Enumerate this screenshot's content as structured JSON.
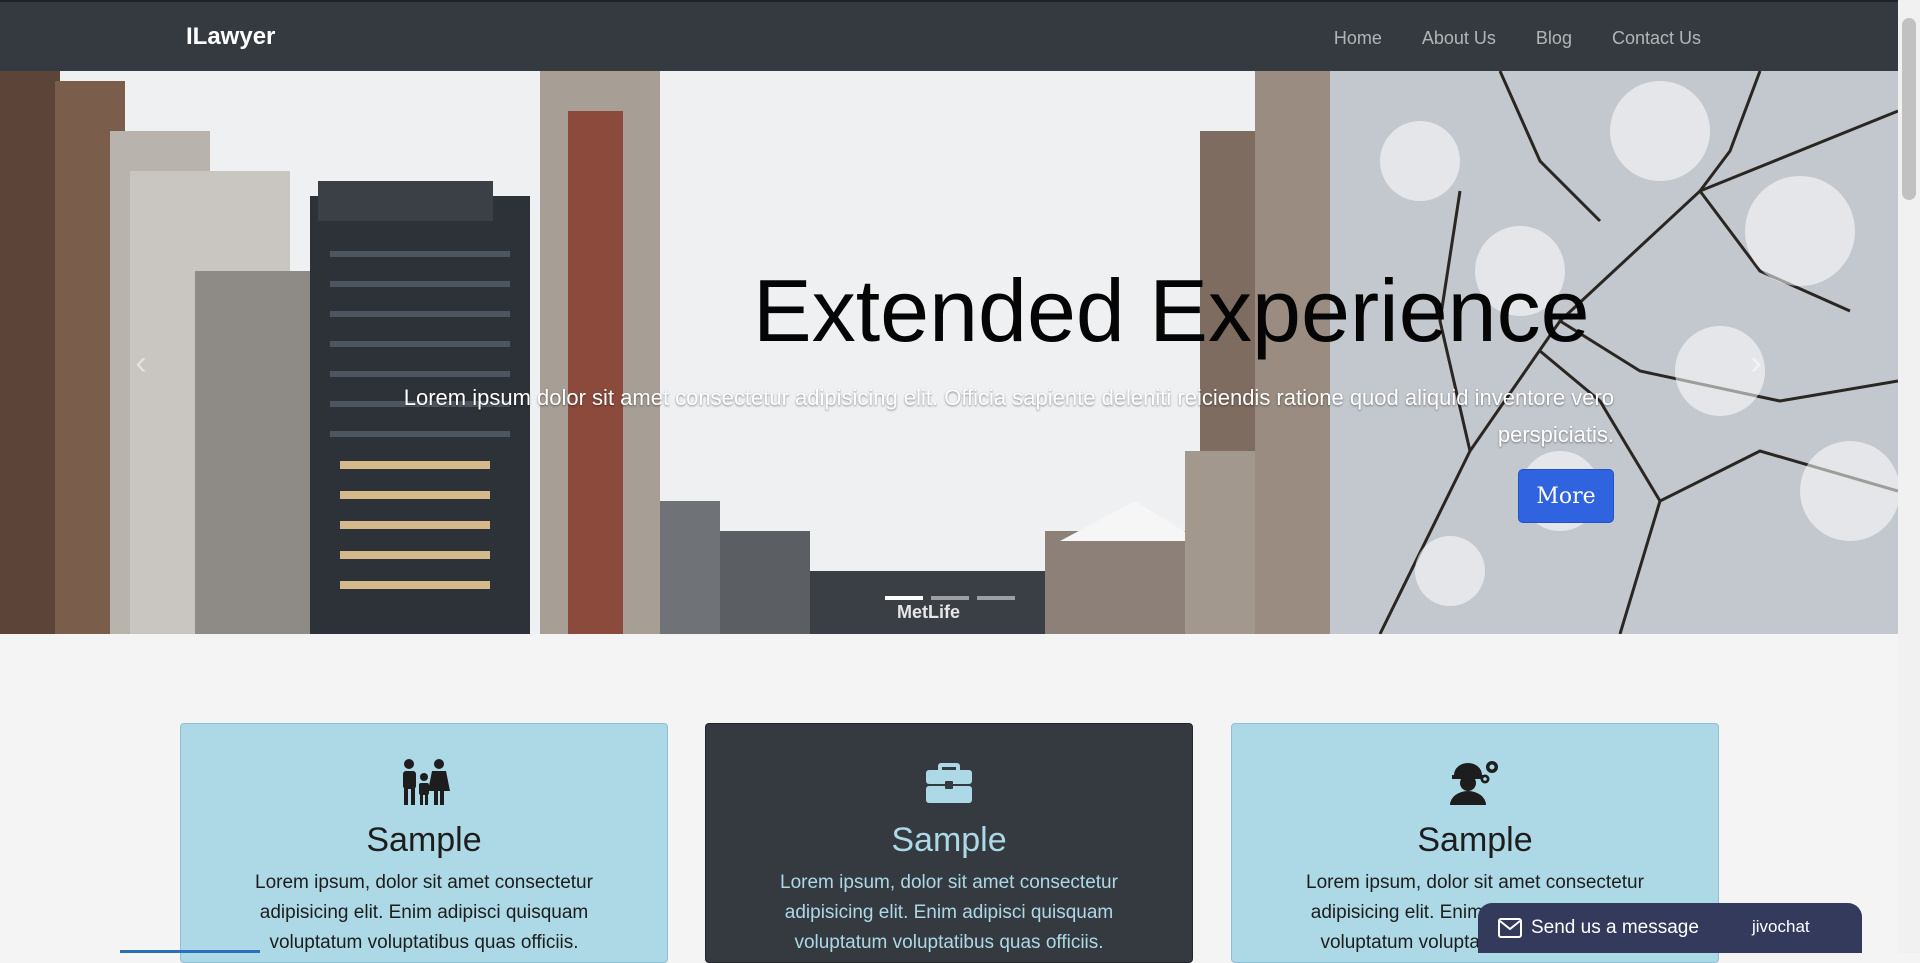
{
  "navbar": {
    "brand": "ILawyer",
    "links": [
      "Home",
      "About Us",
      "Blog",
      "Contact Us"
    ]
  },
  "hero": {
    "title": "Extended Experience",
    "text": "Lorem ipsum dolor sit amet consectetur adipisicing elit. Officia sapiente deleniti reiciendis ratione quod aliquid inventore vero perspiciatis.",
    "button_label": "More",
    "prev_icon": "chevron-left-icon",
    "next_icon": "chevron-right-icon",
    "slides_count": 3,
    "active_slide": 1,
    "sign_text": "MetLife"
  },
  "cards": [
    {
      "icon": "family-icon",
      "title": "Sample",
      "text": "Lorem ipsum, dolor sit amet consectetur adipisicing elit. Enim adipisci quisquam voluptatum voluptatibus quas officiis.",
      "theme": "light"
    },
    {
      "icon": "briefcase-icon",
      "title": "Sample",
      "text": "Lorem ipsum, dolor sit amet consectetur adipisicing elit. Enim adipisci quisquam voluptatum voluptatibus quas officiis.",
      "theme": "dark"
    },
    {
      "icon": "engineer-gears-icon",
      "title": "Sample",
      "text": "Lorem ipsum, dolor sit amet consectetur adipisicing elit. Enim adipisci quisquam voluptatum voluptatibus quas officiis.",
      "theme": "light"
    }
  ],
  "chat_widget": {
    "label": "Send us a message",
    "brand": "jivochat",
    "icon": "envelope-icon"
  },
  "colors": {
    "navbar_bg": "#343a40",
    "card_light": "#add8e6",
    "card_dark": "#343a40",
    "button_blue": "#2f63e0",
    "chat_bg": "#343a5c"
  }
}
